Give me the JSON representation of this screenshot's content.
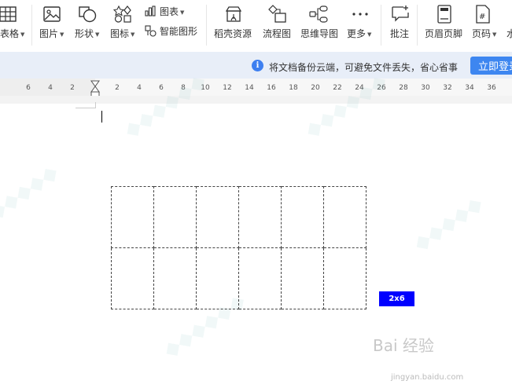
{
  "toolbar": {
    "table_label": "表格",
    "picture_label": "图片",
    "shape_label": "形状",
    "icon_label": "图标",
    "chart_label": "图表",
    "smart_graphic_label": "智能图形",
    "docer_label": "稻壳资源",
    "flowchart_label": "流程图",
    "mindmap_label": "思维导图",
    "more_label": "更多",
    "comment_label": "批注",
    "header_footer_label": "页眉页脚",
    "page_number_label": "页码",
    "cut_label": "水"
  },
  "notice": {
    "info_symbol": "i",
    "text": "将文档备份云端，可避免文件丢失，省心省事",
    "login_label": "立即登录"
  },
  "ruler": {
    "left": [
      "6",
      "4",
      "2"
    ],
    "right": [
      "2",
      "4",
      "6",
      "8",
      "10",
      "12",
      "14",
      "16",
      "18",
      "20",
      "22",
      "24",
      "26",
      "28",
      "30",
      "32",
      "34",
      "36"
    ]
  },
  "document": {
    "table_rows": 2,
    "table_cols": 6,
    "size_badge": "2x6"
  },
  "watermark": {
    "logo": "Bai  经验",
    "url": "jingyan.baidu.com"
  }
}
